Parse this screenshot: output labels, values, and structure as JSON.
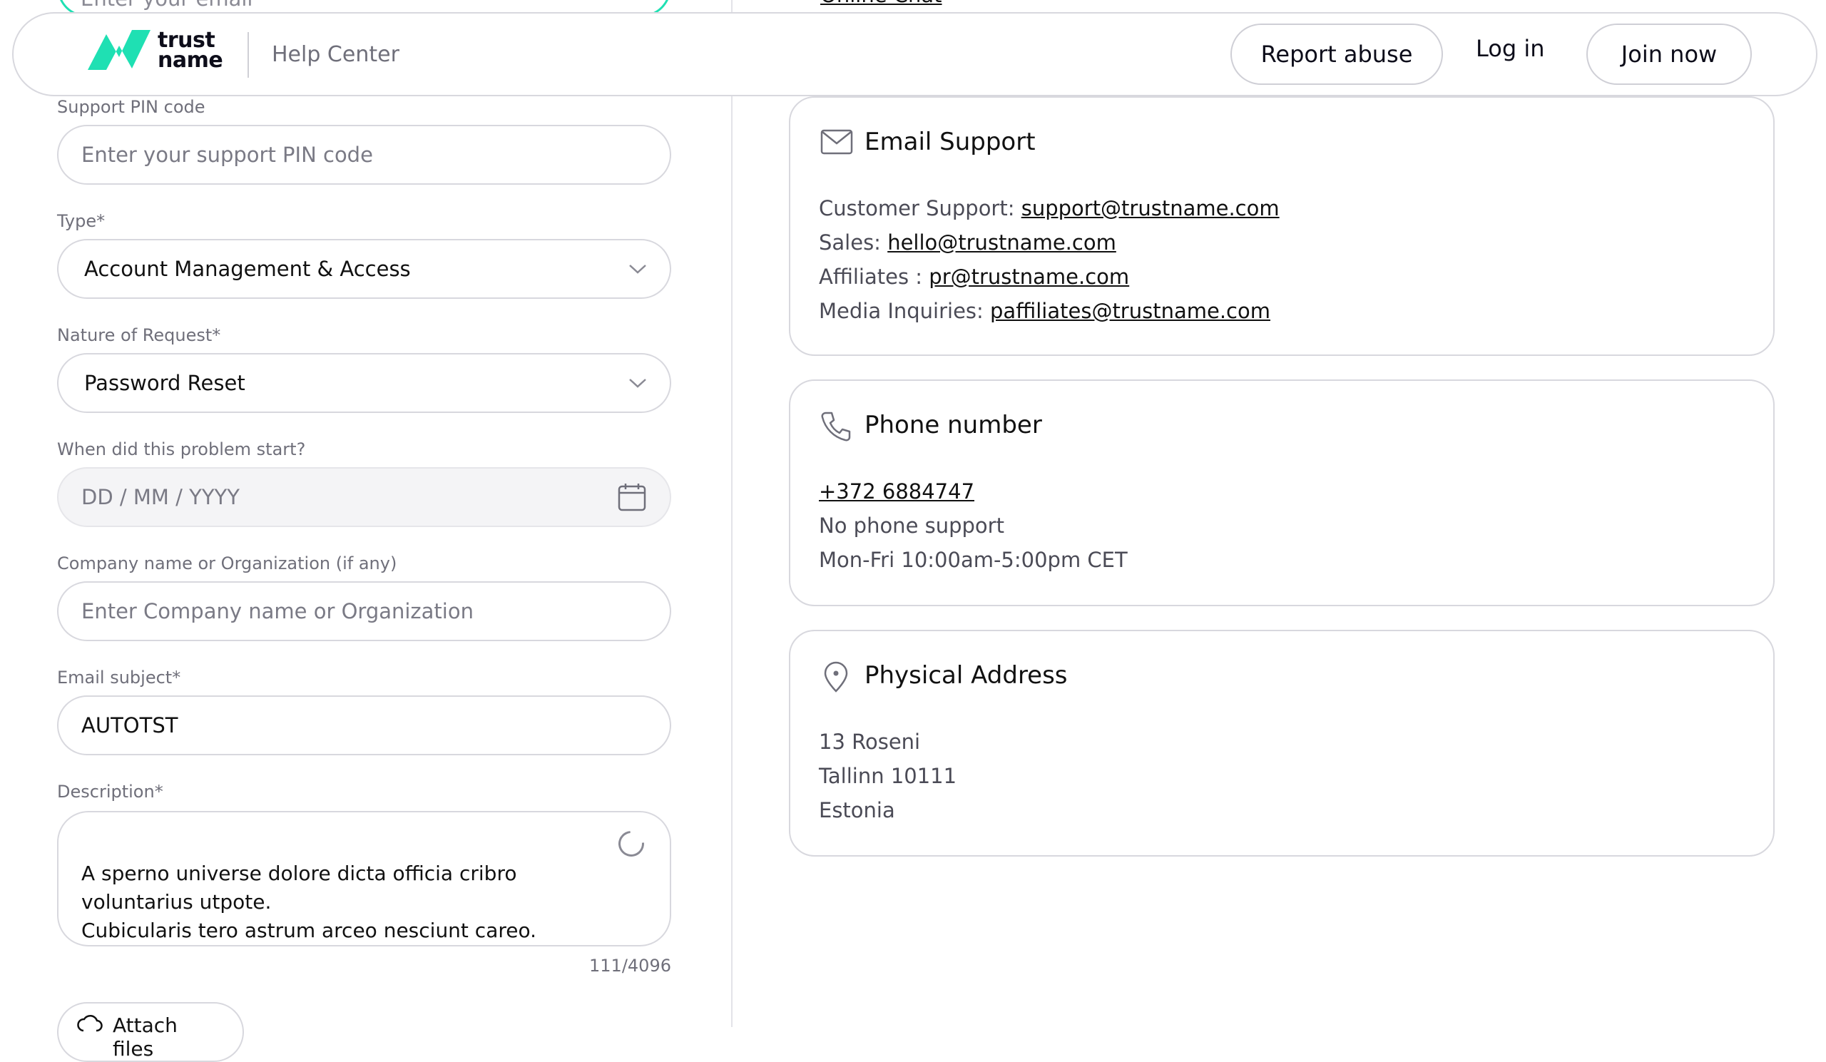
{
  "header": {
    "logo_line1": "trust",
    "logo_line2": "name",
    "help_center": "Help Center",
    "report_abuse": "Report abuse",
    "log_in": "Log in",
    "join_now": "Join now"
  },
  "form": {
    "email_placeholder": "Enter your email",
    "pin_label": "Support PIN code",
    "pin_placeholder": "Enter your support PIN code",
    "type_label": "Type*",
    "type_value": "Account Management & Access",
    "nature_label": "Nature of Request*",
    "nature_value": "Password Reset",
    "date_label": "When did this problem start?",
    "date_placeholder": "DD / MM / YYYY",
    "company_label": "Company name or Organization (if any)",
    "company_placeholder": "Enter Company name or Organization",
    "subject_label": "Email subject*",
    "subject_value": "AUTOTST",
    "description_label": "Description*",
    "description_value": "A sperno universe dolore dicta officia cribro voluntarius utpote.\nCubicularis tero astrum arceo nesciunt careo.",
    "counter": "111/4096",
    "attach_label": "Attach files"
  },
  "contact": {
    "top_link": "Online Chat",
    "email_card": {
      "title": "Email Support",
      "lines": [
        {
          "label": "Customer Support:",
          "value": "support@trustname.com"
        },
        {
          "label": "Sales:",
          "value": "hello@trustname.com"
        },
        {
          "label": "Affiliates :",
          "value": "pr@trustname.com"
        },
        {
          "label": "Media Inquiries:",
          "value": "paffiliates@trustname.com"
        }
      ]
    },
    "phone_card": {
      "title": "Phone number",
      "number": "+372 6884747",
      "note": "No phone support",
      "hours": "Mon-Fri 10:00am-5:00pm CET"
    },
    "address_card": {
      "title": "Physical Address",
      "line1": "13 Roseni",
      "line2": "Tallinn 10111",
      "line3": "Estonia"
    }
  },
  "colors": {
    "accent": "#1fe0b3",
    "text": "#0d0d1a",
    "muted": "#6f6f7a",
    "border": "#d8d8de"
  }
}
